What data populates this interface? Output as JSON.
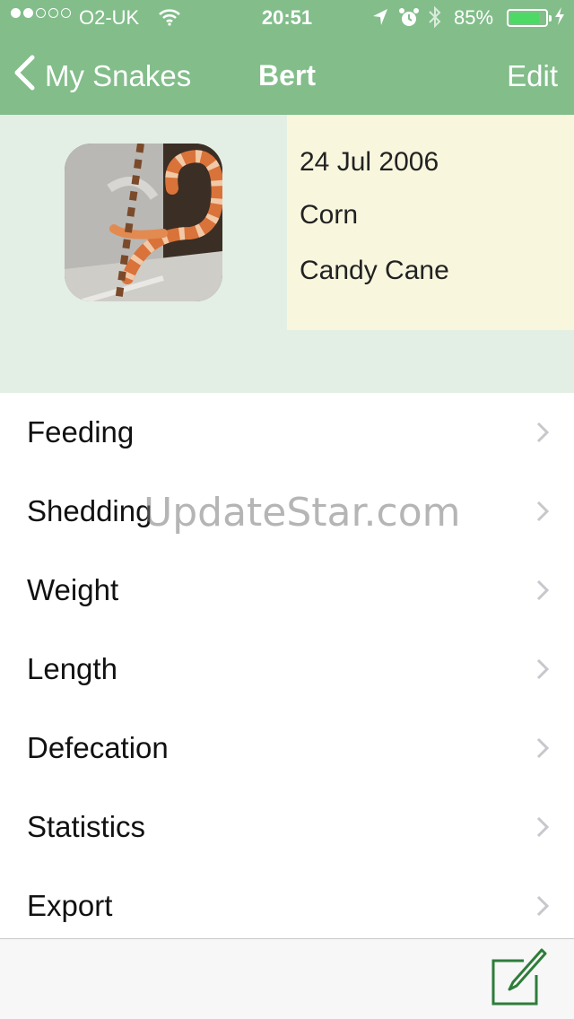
{
  "status_bar": {
    "carrier": "O2-UK",
    "time": "20:51",
    "battery_percent": "85%",
    "battery_level": 0.85,
    "signal_bars_filled": 2,
    "signal_bars_total": 5
  },
  "nav": {
    "back_label": "My Snakes",
    "title": "Bert",
    "edit_label": "Edit"
  },
  "snake": {
    "hatch_date": "24 Jul 2006",
    "species": "Corn",
    "morph": "Candy Cane"
  },
  "menu": {
    "items": [
      {
        "label": "Feeding"
      },
      {
        "label": "Shedding"
      },
      {
        "label": "Weight"
      },
      {
        "label": "Length"
      },
      {
        "label": "Defecation"
      },
      {
        "label": "Statistics"
      },
      {
        "label": "Export"
      }
    ]
  },
  "watermark": "UpdateStar.com",
  "colors": {
    "nav_bar": "#82bd8a",
    "header_bg": "#e3efe4",
    "info_bg": "#f8f7de",
    "compose_icon": "#2e7d3a",
    "battery_fill": "#4cd964"
  },
  "icons": {
    "back": "chevron-left-icon",
    "row_disclosure": "chevron-right-icon",
    "compose": "compose-icon"
  }
}
